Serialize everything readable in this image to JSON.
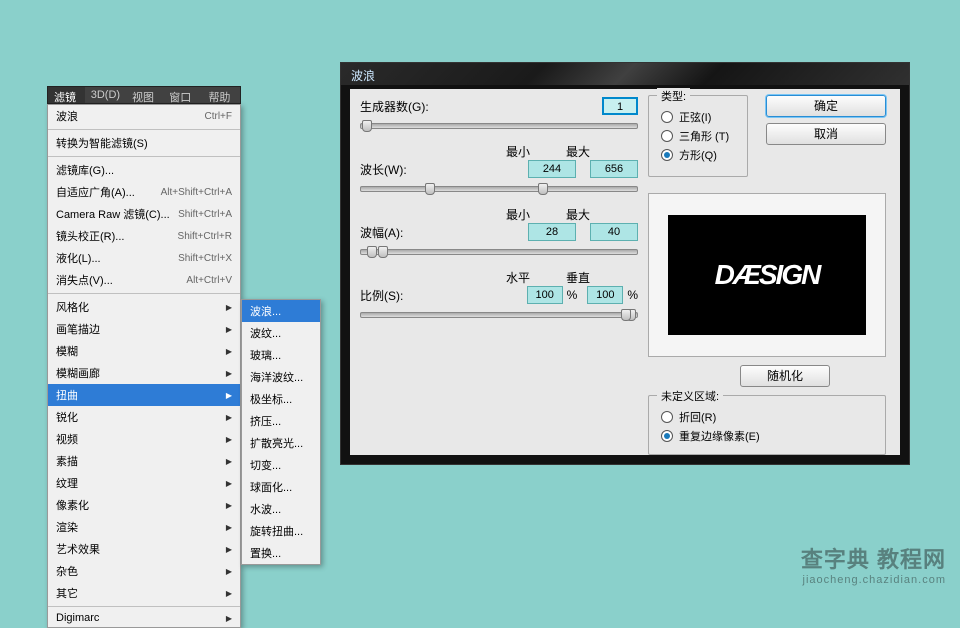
{
  "menubar": {
    "items": [
      "滤镜(T)",
      "3D(D)",
      "视图(V)",
      "窗口(W)",
      "帮助(H)"
    ]
  },
  "menu": {
    "wave": {
      "label": "波浪",
      "shortcut": "Ctrl+F"
    },
    "smartfilter": {
      "label": "转换为智能滤镜(S)"
    },
    "gallery": {
      "label": "滤镜库(G)..."
    },
    "adaptive": {
      "label": "自适应广角(A)...",
      "shortcut": "Alt+Shift+Ctrl+A"
    },
    "cameraraw": {
      "label": "Camera Raw 滤镜(C)...",
      "shortcut": "Shift+Ctrl+A"
    },
    "lens": {
      "label": "镜头校正(R)...",
      "shortcut": "Shift+Ctrl+R"
    },
    "liquify": {
      "label": "液化(L)...",
      "shortcut": "Shift+Ctrl+X"
    },
    "vanish": {
      "label": "消失点(V)...",
      "shortcut": "Alt+Ctrl+V"
    },
    "stylize": {
      "label": "风格化"
    },
    "brush": {
      "label": "画笔描边"
    },
    "blur": {
      "label": "模糊"
    },
    "blurg": {
      "label": "模糊画廊"
    },
    "distort": {
      "label": "扭曲"
    },
    "sharpen": {
      "label": "锐化"
    },
    "video": {
      "label": "视频"
    },
    "sketch": {
      "label": "素描"
    },
    "texture": {
      "label": "纹理"
    },
    "pixelate": {
      "label": "像素化"
    },
    "render": {
      "label": "渲染"
    },
    "artistic": {
      "label": "艺术效果"
    },
    "noise": {
      "label": "杂色"
    },
    "other": {
      "label": "其它"
    },
    "digimarc": {
      "label": "Digimarc"
    }
  },
  "submenu": {
    "items": [
      "波浪...",
      "波纹...",
      "玻璃...",
      "海洋波纹...",
      "极坐标...",
      "挤压...",
      "扩散亮光...",
      "切变...",
      "球面化...",
      "水波...",
      "旋转扭曲...",
      "置换..."
    ]
  },
  "dialog": {
    "title": "波浪",
    "generators": {
      "label": "生成器数(G):",
      "value": "1"
    },
    "wavelength": {
      "label": "波长(W):",
      "min_h": "最小",
      "max_h": "最大",
      "min": "244",
      "max": "656"
    },
    "amplitude": {
      "label": "波幅(A):",
      "min_h": "最小",
      "max_h": "最大",
      "min": "28",
      "max": "40"
    },
    "scale": {
      "label": "比例(S):",
      "h_h": "水平",
      "v_h": "垂直",
      "h": "100",
      "v": "100",
      "pct": "%"
    },
    "type": {
      "title": "类型:",
      "sine": "正弦(I)",
      "tri": "三角形 (T)",
      "square": "方形(Q)"
    },
    "undef": {
      "title": "未定义区域:",
      "wrap": "折回(R)",
      "repeat": "重复边缘像素(E)"
    },
    "ok": "确定",
    "cancel": "取消",
    "randomize": "随机化",
    "preview_text": "DÆSIGN"
  },
  "watermark": {
    "top": "查字典 教程网",
    "bottom": "jiaocheng.chazidian.com"
  }
}
